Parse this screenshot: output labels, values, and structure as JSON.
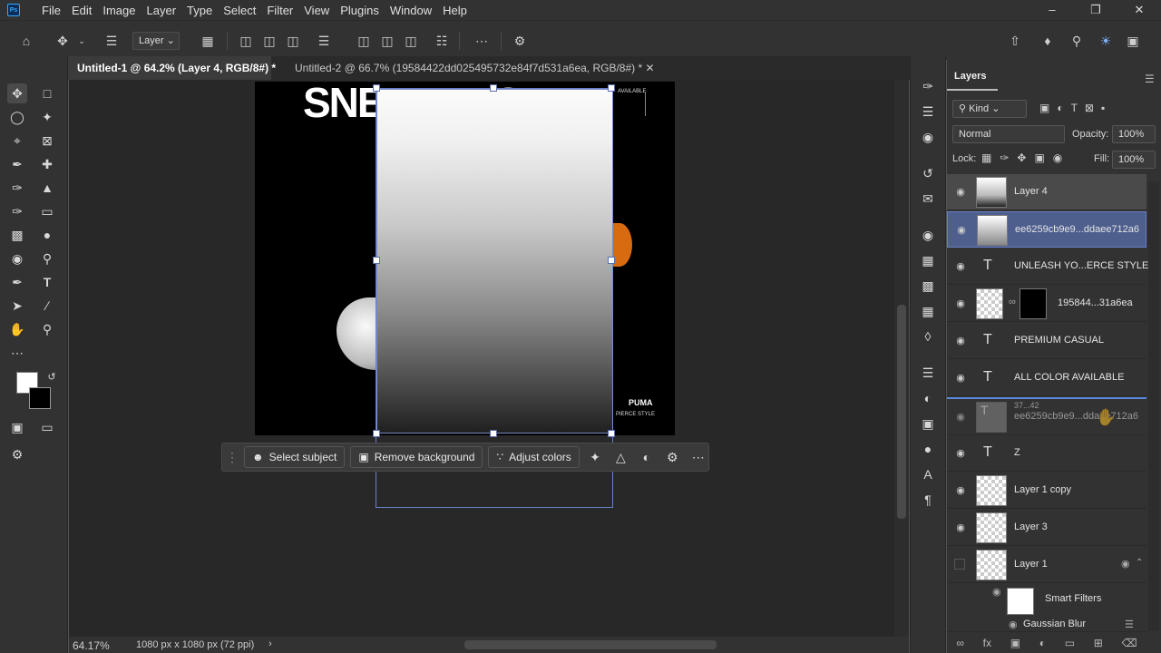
{
  "menubar": {
    "app_icon": "Ps",
    "items": [
      "File",
      "Edit",
      "Image",
      "Layer",
      "Type",
      "Select",
      "Filter",
      "View",
      "Plugins",
      "Window",
      "Help"
    ]
  },
  "options": {
    "layer_select": "Layer"
  },
  "tabs": [
    {
      "label": "Untitled-1 @ 64.2% (Layer 4, RGB/8#) *"
    },
    {
      "label": "Untitled-2 @ 66.7% (19584422dd025495732e84f7d531a6ea, RGB/8#) *"
    }
  ],
  "canvas": {
    "headline": "SNEAKERS",
    "available": "AVAILABLE",
    "brand": "PUMA",
    "tagline": "PIERCE STYLE"
  },
  "contextbar": {
    "select_subject": "Select subject",
    "remove_background": "Remove background",
    "adjust_colors": "Adjust colors"
  },
  "status": {
    "zoom": "64.17%",
    "doc_info": "1080 px x 1080 px (72 ppi)"
  },
  "layers_panel": {
    "title": "Layers",
    "filter_kind": "Kind",
    "blend_mode": "Normal",
    "opacity_label": "Opacity:",
    "opacity": "100%",
    "lock_label": "Lock:",
    "fill_label": "Fill:",
    "fill": "100%",
    "layers": [
      {
        "name": "Layer 4",
        "kind": "gradient",
        "state": "selected-light"
      },
      {
        "name": "ee6259cb9e9...ddaee712a6",
        "kind": "smart",
        "state": "selected"
      },
      {
        "name": "UNLEASH YO...ERCE STYLE",
        "kind": "text"
      },
      {
        "name": "195844...31a6ea",
        "kind": "masked"
      },
      {
        "name": "PREMIUM CASUAL",
        "kind": "text"
      },
      {
        "name": "ALL COLOR AVAILABLE",
        "kind": "text"
      },
      {
        "name": "ee6259cb9e9...ddaee712a6",
        "kind": "drag-ghost",
        "ghost_text": "37...42"
      },
      {
        "name": "Z",
        "kind": "text"
      },
      {
        "name": "Layer 1 copy",
        "kind": "image"
      },
      {
        "name": "Layer 3",
        "kind": "empty"
      },
      {
        "name": "Layer 1",
        "kind": "smart-parent"
      }
    ],
    "smart_filters": "Smart Filters",
    "gaussian_blur": "Gaussian Blur"
  }
}
